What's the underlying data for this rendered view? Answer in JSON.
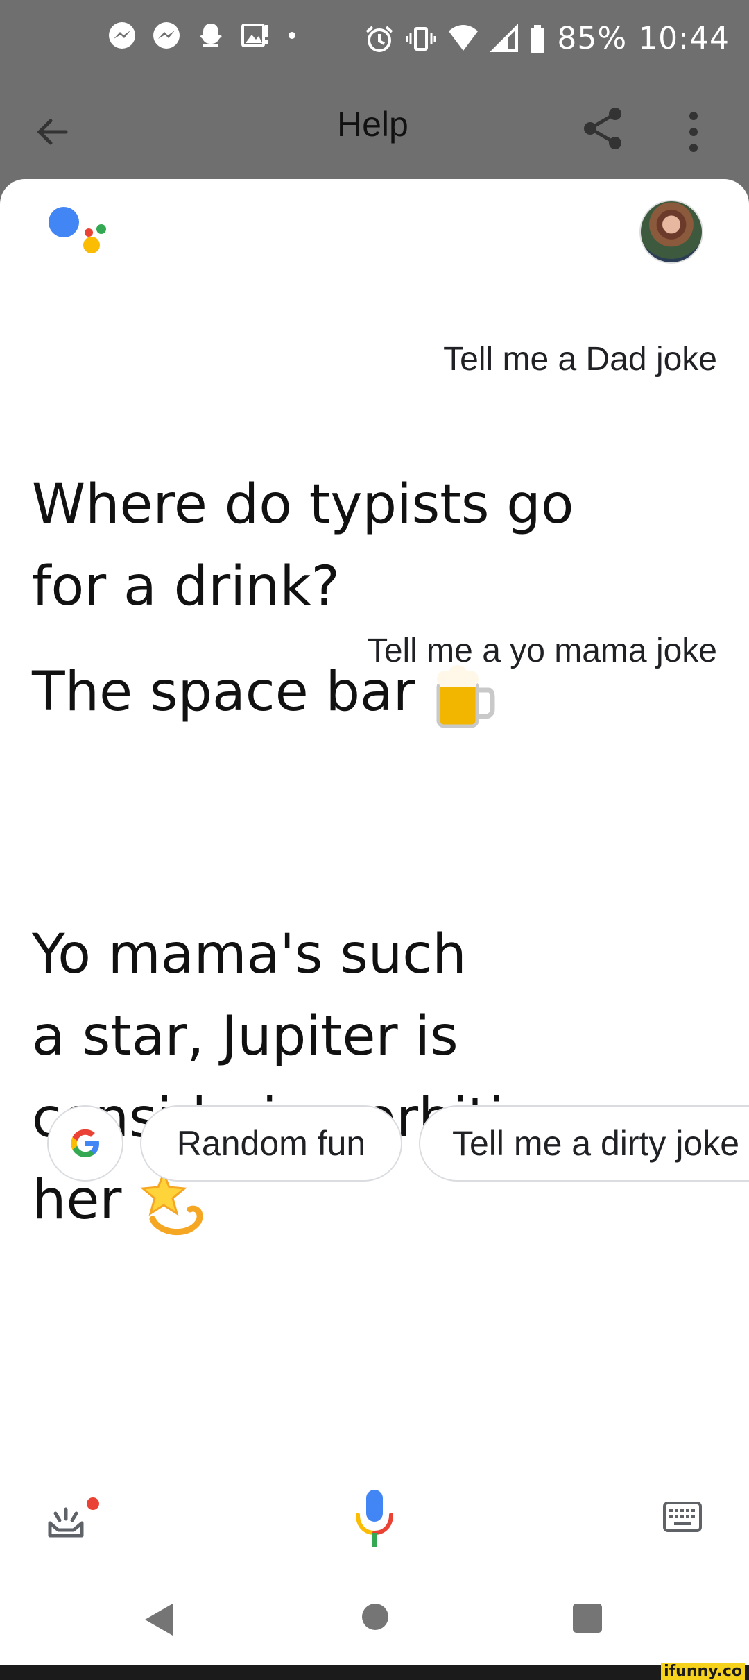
{
  "status_bar": {
    "battery": "85%",
    "time": "10:44",
    "left_icons": [
      "messenger-icon",
      "messenger-icon",
      "snapchat-icon",
      "gallery-alert-icon",
      "dot-icon"
    ],
    "right_icons": [
      "alarm-icon",
      "vibrate-icon",
      "wifi-icon",
      "signal-icon",
      "battery-icon"
    ]
  },
  "app_bar": {
    "title": "Help",
    "back_icon": "arrow-back-icon",
    "share_icon": "share-icon",
    "more_icon": "more-vert-icon"
  },
  "conversation": {
    "assistant_logo": "google-assistant-logo",
    "messages": [
      {
        "role": "user",
        "text": "Tell me a Dad joke"
      },
      {
        "role": "assistant",
        "lines": [
          "Where do typists go",
          "for a drink?"
        ]
      },
      {
        "role": "assistant",
        "text": "The space bar",
        "emoji": "beer-mug-emoji"
      },
      {
        "role": "user",
        "text": "Tell me a yo mama joke"
      },
      {
        "role": "assistant",
        "lines": [
          "Yo mama's such",
          "a star, Jupiter is",
          "considering orbiting",
          "her"
        ],
        "emoji": "dizzy-star-emoji"
      }
    ]
  },
  "suggestions": {
    "google_icon": "google-g-icon",
    "chips": [
      "Random fun",
      "Tell me a dirty joke"
    ]
  },
  "bottom_actions": {
    "explore_icon": "explore-snapshot-icon",
    "mic_icon": "mic-icon",
    "keyboard_icon": "keyboard-icon"
  },
  "nav_bar": {
    "icons": [
      "nav-back-icon",
      "nav-home-icon",
      "nav-recents-icon"
    ]
  },
  "watermark": {
    "text": "ifunny.co",
    "accent": "#f6d21c"
  },
  "colors": {
    "google_blue": "#4285F4",
    "google_red": "#EA4335",
    "google_yellow": "#FBBC04",
    "google_green": "#34A853",
    "header_gray": "#6f6f6f"
  }
}
